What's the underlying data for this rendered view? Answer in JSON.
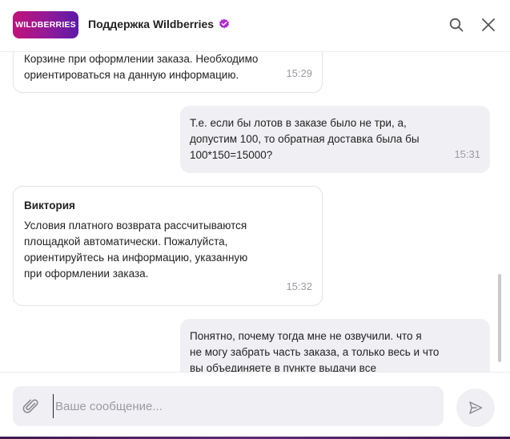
{
  "header": {
    "logo_text": "WILDBERRIES",
    "title": "Поддержка Wildberries",
    "verified_icon": "verified-badge-icon",
    "search_icon": "search-icon",
    "close_icon": "close-icon",
    "brand_color": "#a0169a"
  },
  "messages": [
    {
      "direction": "incoming",
      "author": "",
      "text": "Корзине при оформлении заказа. Необходимо\nориентироваться на данную информацию.",
      "time": "15:29"
    },
    {
      "direction": "outgoing",
      "author": "",
      "text": "Т.е. если бы лотов в заказе было не три, а,\nдопустим 100, то обратная доставка была бы\n100*150=15000?",
      "time": "15:31"
    },
    {
      "direction": "incoming",
      "author": "Виктория",
      "text": "Условия платного возврата рассчитываются\nплощадкой автоматически. Пожалуйста,\nориентируйтесь на информацию, указанную\nпри оформлении заказа.",
      "time": "15:32"
    },
    {
      "direction": "outgoing",
      "author": "",
      "text": "Понятно, почему тогда мне не озвучили. что я\nне могу забрать часть заказа, а только весь и что\nвы объединяете в пункте выдачи все",
      "time": ""
    }
  ],
  "composer": {
    "placeholder": "Ваше сообщение...",
    "value": "",
    "attach_icon": "paperclip-icon",
    "send_icon": "send-icon"
  }
}
